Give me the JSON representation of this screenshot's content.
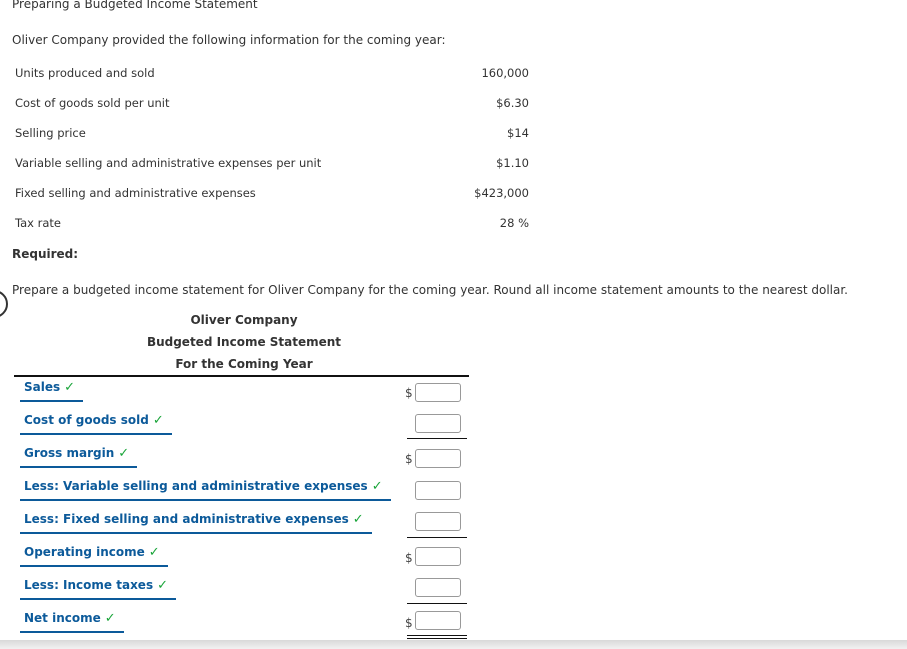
{
  "page_title": "Preparing a Budgeted Income Statement",
  "intro": "Oliver Company provided the following information for the coming year:",
  "info": [
    {
      "label": "Units produced and sold",
      "value": "160,000"
    },
    {
      "label": "Cost of goods sold per unit",
      "value": "$6.30"
    },
    {
      "label": "Selling price",
      "value": "$14"
    },
    {
      "label": "Variable selling and administrative expenses per unit",
      "value": "$1.10"
    },
    {
      "label": "Fixed selling and administrative expenses",
      "value": "$423,000"
    },
    {
      "label": "Tax rate",
      "value": "28 %"
    }
  ],
  "required_label": "Required:",
  "instructions": "Prepare a budgeted income statement for Oliver Company for the coming year. Round all income statement amounts to the nearest dollar.",
  "statement": {
    "company": "Oliver Company",
    "title": "Budgeted Income Statement",
    "period": "For the Coming Year",
    "check_glyph": "✓",
    "currency_symbol": "$",
    "check_color": "#1aa53a",
    "label_color": "#0c5a9a",
    "rows": [
      {
        "label": "Sales",
        "value": "",
        "show_dollar": true
      },
      {
        "label": "Cost of goods sold",
        "value": "",
        "show_dollar": false
      },
      {
        "label": "Gross margin",
        "value": "",
        "show_dollar": true
      },
      {
        "label": "Less: Variable selling and administrative expenses",
        "value": "",
        "show_dollar": false
      },
      {
        "label": "Less: Fixed selling and administrative expenses",
        "value": "",
        "show_dollar": false
      },
      {
        "label": "Operating income",
        "value": "",
        "show_dollar": true
      },
      {
        "label": "Less: Income taxes",
        "value": "",
        "show_dollar": false
      },
      {
        "label": "Net income",
        "value": "",
        "show_dollar": true
      }
    ]
  }
}
